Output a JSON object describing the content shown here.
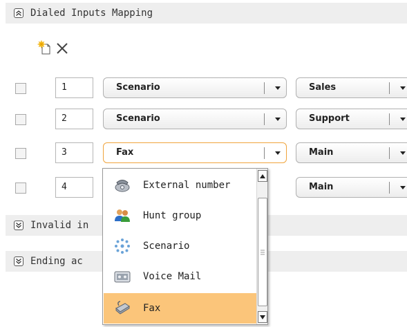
{
  "sections": {
    "dialed_inputs": {
      "title": "Dialed Inputs Mapping"
    },
    "invalid_input": {
      "title": "Invalid in"
    },
    "ending": {
      "title": "Ending ac"
    }
  },
  "rows": [
    {
      "number": "1",
      "type": "Scenario",
      "target": "Sales"
    },
    {
      "number": "2",
      "type": "Scenario",
      "target": "Support"
    },
    {
      "number": "3",
      "type": "Fax",
      "target": "Main"
    },
    {
      "number": "4",
      "type": "",
      "target": "Main"
    }
  ],
  "dropdown": {
    "options": [
      {
        "label": "External number",
        "icon": "phone-icon",
        "selected": false
      },
      {
        "label": "Hunt group",
        "icon": "people-icon",
        "selected": false
      },
      {
        "label": "Scenario",
        "icon": "scenario-icon",
        "selected": false
      },
      {
        "label": "Voice Mail",
        "icon": "voicemail-icon",
        "selected": false
      },
      {
        "label": "Fax",
        "icon": "fax-icon",
        "selected": true
      }
    ]
  },
  "colors": {
    "section_header_bg": "#eeeeee",
    "active_border": "#f0a43c",
    "selected_option_bg": "#fbc57a"
  }
}
